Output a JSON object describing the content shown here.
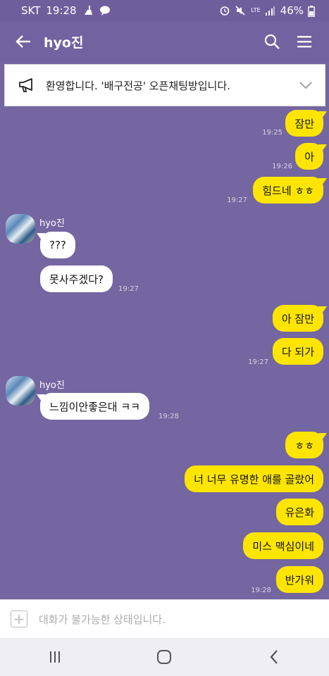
{
  "status_bar": {
    "carrier": "SKT",
    "time": "19:28",
    "lte": "LTE",
    "battery": "46%"
  },
  "header": {
    "title": "hyo진"
  },
  "notice": {
    "text": "환영합니다. '배구전공' 오픈채팅방입니다."
  },
  "messages": [
    {
      "text": "잠만",
      "time": "19:25"
    },
    {
      "text": "아",
      "time": "19:26"
    },
    {
      "text": "힘드네 ㅎㅎ",
      "time": "19:27"
    },
    {
      "sender": "hyo진"
    },
    {
      "text": "???"
    },
    {
      "text": "못사주겠다?",
      "time": "19:27"
    },
    {
      "text": "아 잠만"
    },
    {
      "text": "다 되가",
      "time": "19:27"
    },
    {
      "sender": "hyo진"
    },
    {
      "text": "느낌이안좋은대 ㅋㅋ",
      "time": "19:28"
    },
    {
      "text": "ㅎㅎ"
    },
    {
      "text": "너 너무 유명한 애를 골랐어"
    },
    {
      "text": "유은화"
    },
    {
      "text": "미스 맥심이네"
    },
    {
      "text": "반가워",
      "time": "19:28"
    }
  ],
  "input_bar": {
    "placeholder": "대화가 불가능한 상태입니다."
  },
  "colors": {
    "background": "#7466a0",
    "my_bubble": "#fee500",
    "their_bubble": "#ffffff"
  },
  "icons": [
    "back-arrow-icon",
    "search-icon",
    "menu-icon",
    "megaphone-icon",
    "chevron-down-icon",
    "plus-icon",
    "recent-apps-icon",
    "home-icon",
    "back-icon"
  ]
}
